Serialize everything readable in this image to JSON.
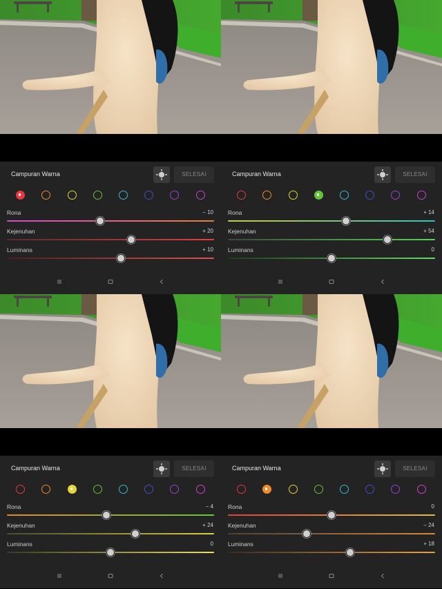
{
  "panels": [
    {
      "title": "Campuran Warna",
      "done_label": "SELESAI",
      "selected": 0,
      "sliders": [
        {
          "label": "Rona",
          "value": "– 10",
          "pos": 0.45,
          "track": [
            "#d24cd2",
            "#e0823a"
          ]
        },
        {
          "label": "Kejenuhan",
          "value": "+ 20",
          "pos": 0.6,
          "track": [
            "#5a2a2a",
            "#e04040"
          ]
        },
        {
          "label": "Luminans",
          "value": "+ 10",
          "pos": 0.55,
          "track": [
            "#4a1e1e",
            "#e05050"
          ]
        }
      ]
    },
    {
      "title": "Campuran Warna",
      "done_label": "SELESAI",
      "selected": 3,
      "sliders": [
        {
          "label": "Rona",
          "value": "+ 14",
          "pos": 0.57,
          "track": [
            "#c8cc3a",
            "#38c0c0"
          ]
        },
        {
          "label": "Kejenuhan",
          "value": "+ 54",
          "pos": 0.77,
          "track": [
            "#3a4a3a",
            "#56d456"
          ]
        },
        {
          "label": "Luminans",
          "value": "0",
          "pos": 0.5,
          "track": [
            "#1e3a1e",
            "#60e060"
          ]
        }
      ]
    },
    {
      "title": "Campuran Warna",
      "done_label": "SELESAI",
      "selected": 2,
      "sliders": [
        {
          "label": "Rona",
          "value": "– 4",
          "pos": 0.48,
          "track": [
            "#e0883a",
            "#6ac83a"
          ]
        },
        {
          "label": "Kejenuhan",
          "value": "+ 24",
          "pos": 0.62,
          "track": [
            "#4a4a30",
            "#e0d040"
          ]
        },
        {
          "label": "Luminans",
          "value": "0",
          "pos": 0.5,
          "track": [
            "#3a3a1e",
            "#f0e060"
          ]
        }
      ]
    },
    {
      "title": "Campuran Warna",
      "done_label": "SELESAI",
      "selected": 1,
      "sliders": [
        {
          "label": "Rona",
          "value": "0",
          "pos": 0.5,
          "track": [
            "#e04040",
            "#e0c040"
          ]
        },
        {
          "label": "Kejenuhan",
          "value": "– 24",
          "pos": 0.38,
          "track": [
            "#4a4038",
            "#e08838"
          ]
        },
        {
          "label": "Luminans",
          "value": "+ 18",
          "pos": 0.59,
          "track": [
            "#3a2a1e",
            "#f0a040"
          ]
        }
      ]
    }
  ],
  "swatch_colors": [
    "#e8383c",
    "#ef8a2f",
    "#e5d43a",
    "#63c43b",
    "#3ab8d4",
    "#3f4fc4",
    "#9a3fd4",
    "#d43fd0"
  ],
  "icons": {
    "target": "target-adjust-icon",
    "nav_recent": "recent-apps-icon",
    "nav_home": "home-icon",
    "nav_back": "back-icon"
  }
}
